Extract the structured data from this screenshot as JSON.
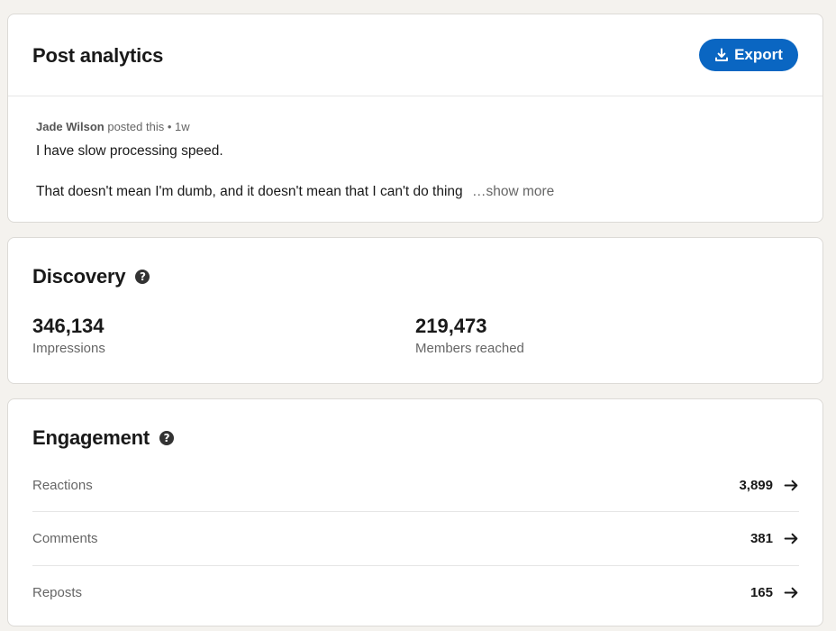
{
  "header": {
    "title": "Post analytics",
    "export_label": "Export"
  },
  "post": {
    "author": "Jade Wilson",
    "meta_suffix": " posted this • 1w",
    "line1": "I have slow processing speed.",
    "line2": "That doesn't mean I'm dumb, and it doesn't mean that I can't do thing",
    "show_more": "…show more"
  },
  "discovery": {
    "title": "Discovery",
    "metrics": [
      {
        "value": "346,134",
        "label": "Impressions"
      },
      {
        "value": "219,473",
        "label": "Members reached"
      }
    ]
  },
  "engagement": {
    "title": "Engagement",
    "rows": [
      {
        "label": "Reactions",
        "value": "3,899"
      },
      {
        "label": "Comments",
        "value": "381"
      },
      {
        "label": "Reposts",
        "value": "165"
      }
    ]
  },
  "colors": {
    "accent": "#0a66c2",
    "background": "#f4f2ee",
    "card": "#ffffff"
  },
  "icons": {
    "export": "download-icon",
    "help": "question-circle-icon",
    "row_link": "arrow-right-icon"
  }
}
